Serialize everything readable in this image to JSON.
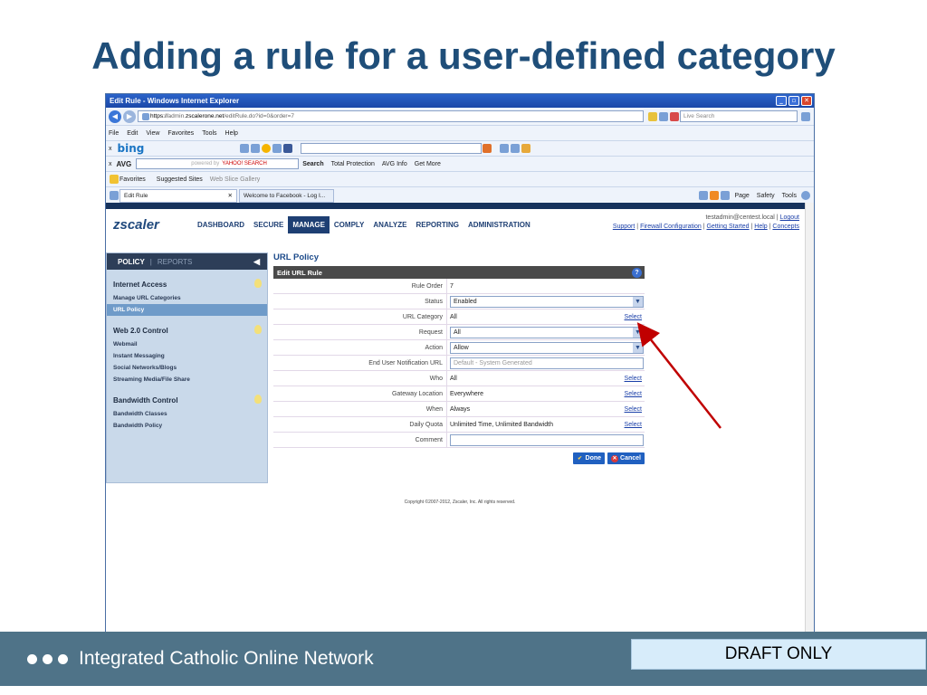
{
  "slide": {
    "title": "Adding a rule for a user-defined category",
    "footer_text": "Integrated Catholic Online Network",
    "draft_label": "DRAFT ONLY"
  },
  "browser": {
    "window_title": "Edit Rule - Windows Internet Explorer",
    "address_scheme": "https://",
    "address_sub": "admin.",
    "address_host": "zscalerone.net",
    "address_path": "/editRule.do?id=0&order=7",
    "search_placeholder": "Live Search",
    "menu": [
      "File",
      "Edit",
      "View",
      "Favorites",
      "Tools",
      "Help"
    ],
    "bing_logo": "bing",
    "avg_logo": "AVG",
    "avg_search": "YAHOO! SEARCH",
    "avg_powered": "powered by",
    "avg_toolbar": [
      "Search",
      "Total Protection",
      "AVG Info",
      "Get More"
    ],
    "favorites_label": "Favorites",
    "favorites_items": [
      "Suggested Sites",
      "Web Slice Gallery"
    ],
    "tabs": [
      "Edit Rule",
      "Welcome to Facebook - Log I..."
    ],
    "command_items": [
      "Page",
      "Safety",
      "Tools"
    ]
  },
  "zscaler": {
    "logo": "zscaler",
    "nav": [
      "DASHBOARD",
      "SECURE",
      "MANAGE",
      "COMPLY",
      "ANALYZE",
      "REPORTING",
      "ADMINISTRATION"
    ],
    "active_nav": "MANAGE",
    "account": "testadmin@centest.local",
    "logout": "Logout",
    "links": [
      "Support",
      "Firewall Configuration",
      "Getting Started",
      "Help",
      "Concepts"
    ]
  },
  "sidebar": {
    "head_active": "POLICY",
    "head_sep": "|",
    "head_inactive": "REPORTS",
    "sections": [
      {
        "title": "Internet Access",
        "items": [
          "Manage URL Categories",
          "URL Policy"
        ]
      },
      {
        "title": "Web 2.0 Control",
        "items": [
          "Webmail",
          "Instant Messaging",
          "Social Networks/Blogs",
          "Streaming Media/File Share"
        ]
      },
      {
        "title": "Bandwidth Control",
        "items": [
          "Bandwidth Classes",
          "Bandwidth Policy"
        ]
      }
    ],
    "active_item": "URL Policy"
  },
  "form": {
    "page_title": "URL Policy",
    "panel_title": "Edit URL Rule",
    "help": "?",
    "rule_order_label": "Rule Order",
    "rule_order_value": "7",
    "status_label": "Status",
    "status_value": "Enabled",
    "url_category_label": "URL Category",
    "url_category_value": "All",
    "request_label": "Request",
    "request_value": "All",
    "action_label": "Action",
    "action_value": "Allow",
    "notification_label": "End User Notification URL",
    "notification_placeholder": "Default - System Generated",
    "who_label": "Who",
    "who_value": "All",
    "gateway_label": "Gateway Location",
    "gateway_value": "Everywhere",
    "when_label": "When",
    "when_value": "Always",
    "quota_label": "Daily Quota",
    "quota_value": "Unlimited Time, Unlimited Bandwidth",
    "comment_label": "Comment",
    "select_link": "Select",
    "done_label": "Done",
    "cancel_label": "Cancel"
  },
  "copyright": "Copyright ©2007-2012, Zscaler, Inc. All rights reserved.",
  "colors": {
    "title": "#1f4e79",
    "arrow": "#c00000",
    "footer": "#4f7388",
    "zscaler_navy": "#1e3f73"
  }
}
